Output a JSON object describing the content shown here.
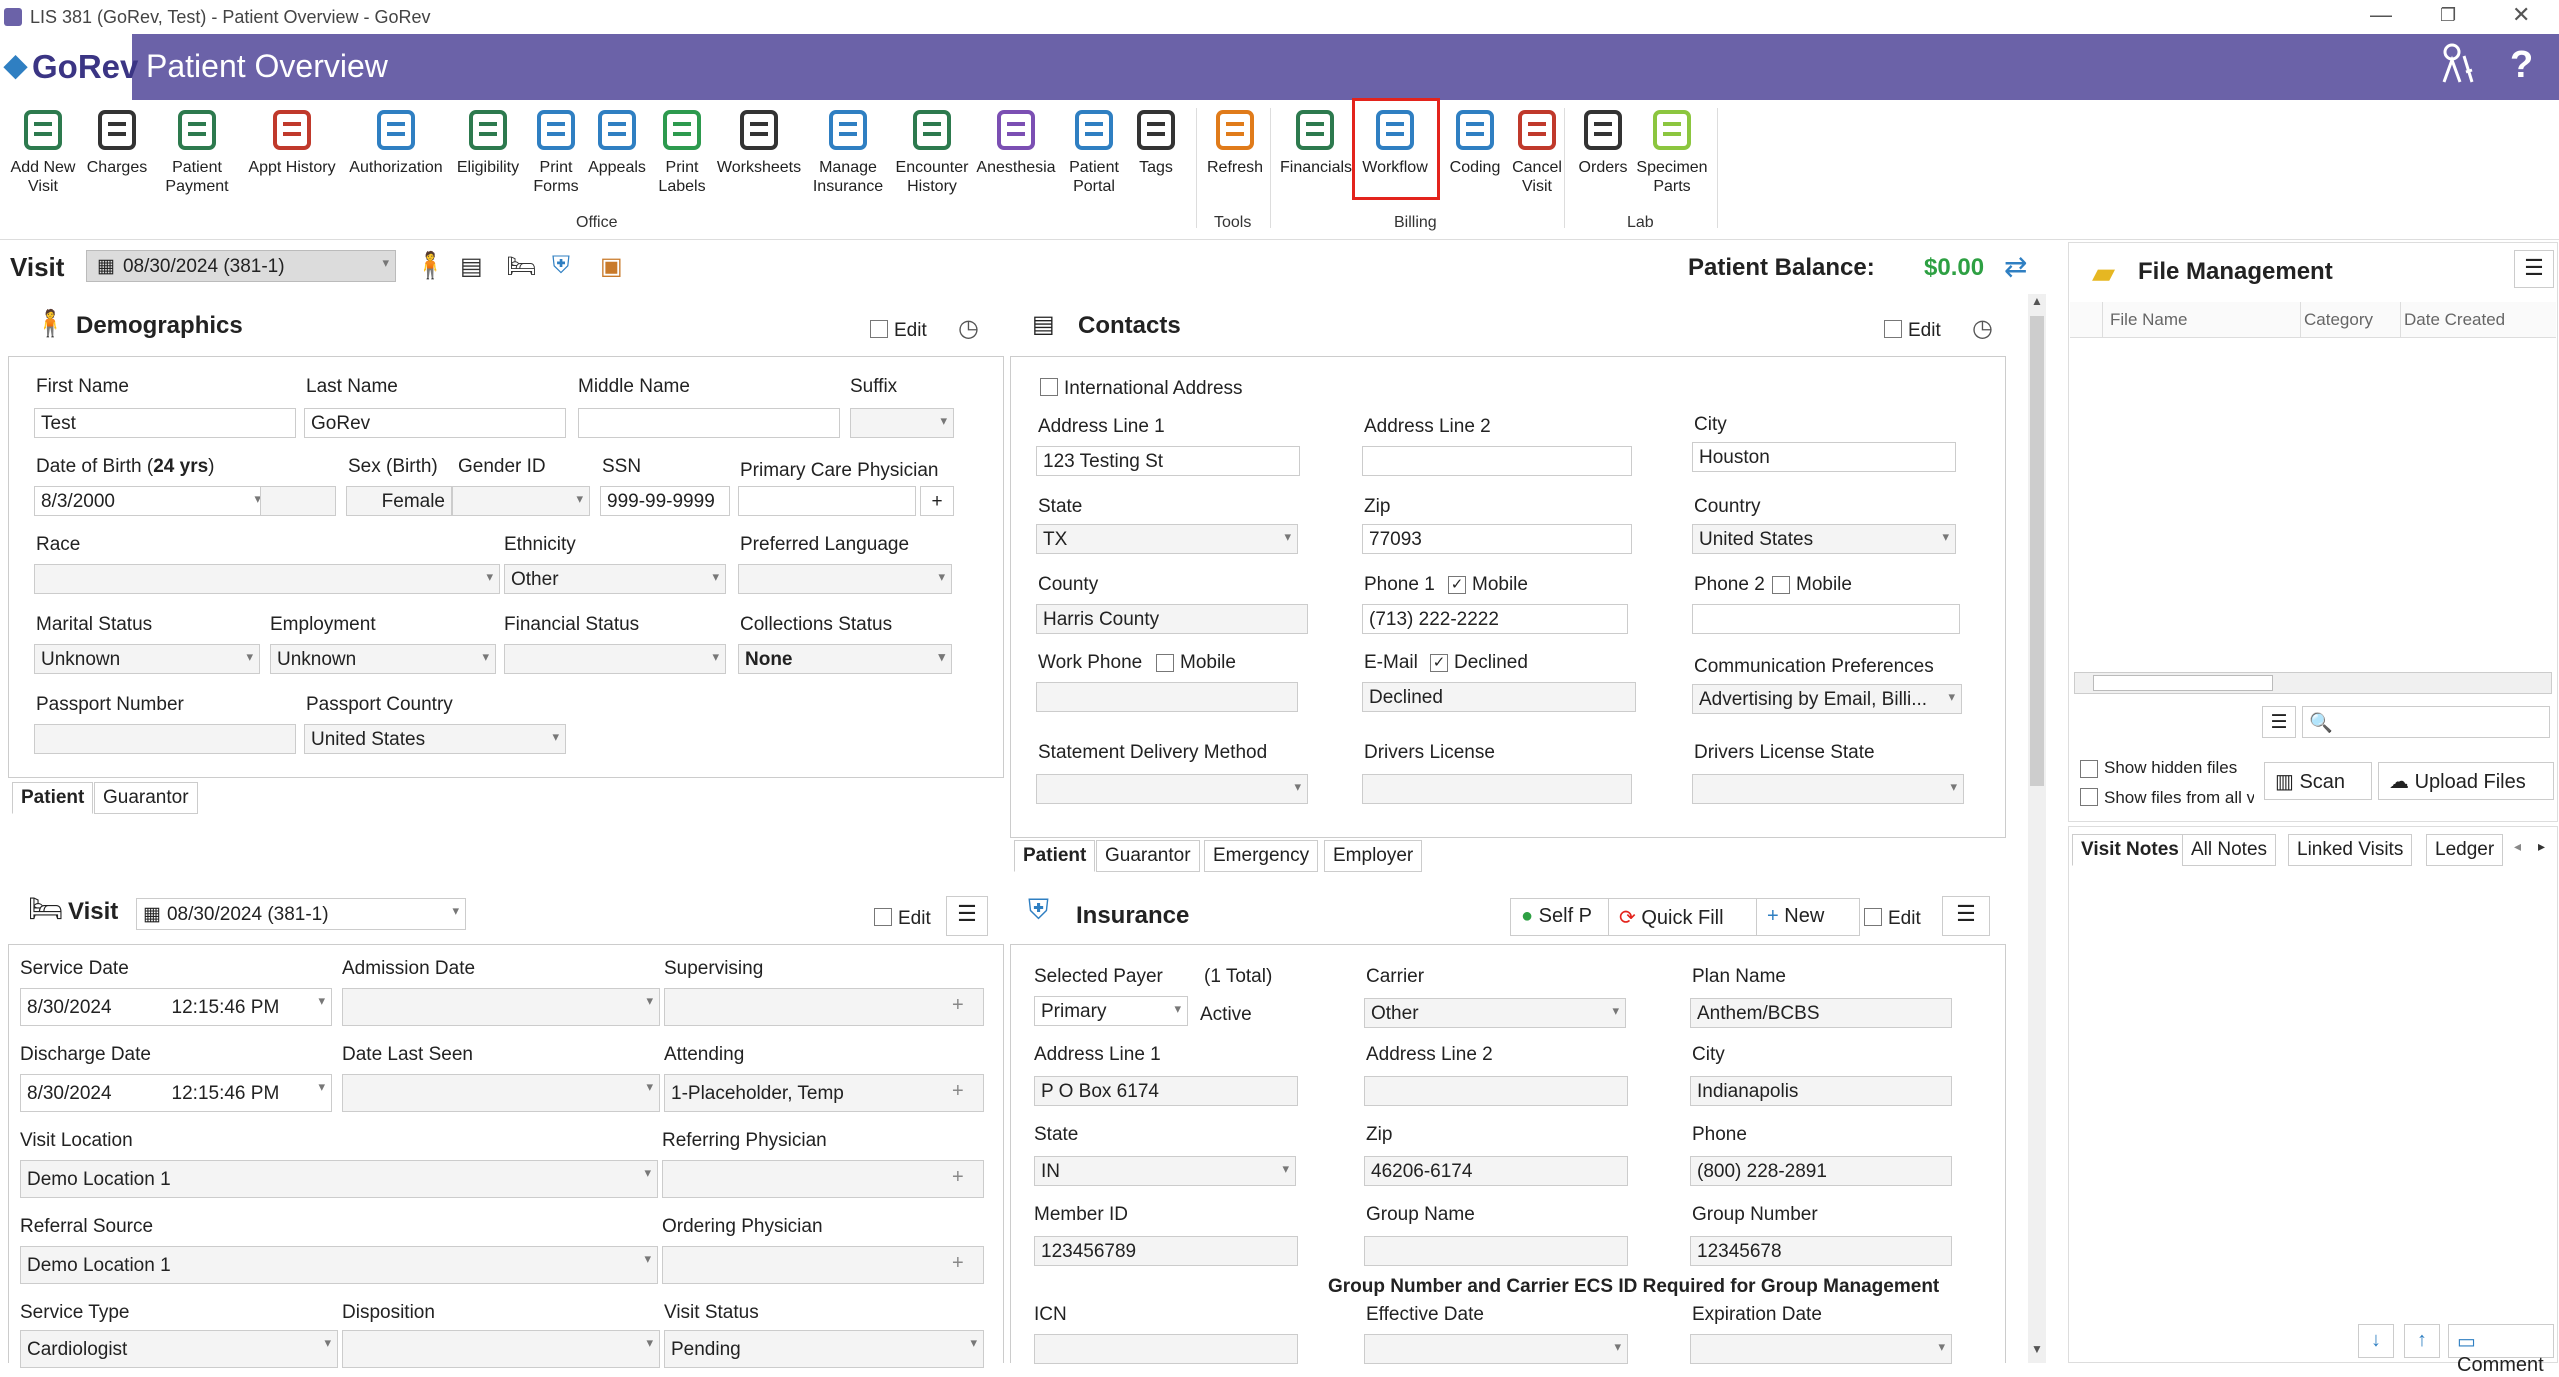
{
  "window": {
    "title": "LIS 381 (GoRev, Test) - Patient Overview - GoRev",
    "min": "—",
    "max": "❐",
    "close": "✕"
  },
  "app": {
    "logo": "GoRev",
    "page_title": "Patient Overview",
    "help": "?"
  },
  "ribbon": {
    "office": [
      "Add New Visit",
      "Charges",
      "Patient Payment",
      "Appt History",
      "Authorization",
      "Eligibility",
      "Print Forms",
      "Appeals",
      "Print Labels",
      "Worksheets",
      "Manage Insurance",
      "Encounter History",
      "Anesthesia",
      "Patient Portal",
      "Tags"
    ],
    "tools": [
      "Refresh"
    ],
    "billing": [
      "Financials",
      "Workflow",
      "Coding",
      "Cancel Visit"
    ],
    "lab": [
      "Orders",
      "Specimen Parts"
    ],
    "groups": {
      "office": "Office",
      "tools": "Tools",
      "billing": "Billing",
      "lab": "Lab"
    }
  },
  "visitbar": {
    "label": "Visit",
    "selected": "08/30/2024 (381-1)",
    "balance_label": "Patient Balance:",
    "balance": "$0.00"
  },
  "demographics": {
    "title": "Demographics",
    "edit": "Edit",
    "first_name_l": "First Name",
    "first_name": "Test",
    "last_name_l": "Last Name",
    "last_name": "GoRev",
    "middle_l": "Middle Name",
    "suffix_l": "Suffix",
    "dob_l": "Date of Birth (",
    "dob_age": "24 yrs",
    "dob_close": ")",
    "dob": "8/3/2000",
    "sex_l": "Sex (Birth)",
    "sex": "Female",
    "gender_l": "Gender ID",
    "ssn_l": "SSN",
    "ssn": "999-99-9999",
    "pcp_l": "Primary Care Physician",
    "race_l": "Race",
    "ethnicity_l": "Ethnicity",
    "ethnicity": "Other",
    "lang_l": "Preferred Language",
    "marital_l": "Marital Status",
    "marital": "Unknown",
    "employment_l": "Employment",
    "employment": "Unknown",
    "financial_l": "Financial Status",
    "collections_l": "Collections Status",
    "collections": "None",
    "passport_l": "Passport Number",
    "passport_country_l": "Passport Country",
    "passport_country": "United States",
    "tabs": [
      "Patient",
      "Guarantor"
    ]
  },
  "contacts": {
    "title": "Contacts",
    "edit": "Edit",
    "intl": "International Address",
    "addr1_l": "Address Line 1",
    "addr1": "123 Testing St",
    "addr2_l": "Address Line 2",
    "city_l": "City",
    "city": "Houston",
    "state_l": "State",
    "state": "TX",
    "zip_l": "Zip",
    "zip": "77093",
    "country_l": "Country",
    "country": "United States",
    "county_l": "County",
    "county": "Harris County",
    "phone1_l": "Phone 1",
    "mobile": "Mobile",
    "phone1": "(713) 222-2222",
    "phone2_l": "Phone 2",
    "work_l": "Work Phone",
    "email_l": "E-Mail",
    "declined_l": "Declined",
    "email": "Declined",
    "comm_l": "Communication Preferences",
    "comm": "Advertising by Email, Billi...",
    "stmt_l": "Statement Delivery Method",
    "dl_l": "Drivers License",
    "dls_l": "Drivers License State",
    "tabs": [
      "Patient",
      "Guarantor",
      "Emergency",
      "Employer"
    ]
  },
  "visit": {
    "title": "Visit",
    "selected": "08/30/2024 (381-1)",
    "edit": "Edit",
    "service_date_l": "Service Date",
    "service_date": "8/30/2024",
    "service_time": "12:15:46 PM",
    "admission_l": "Admission Date",
    "supervising_l": "Supervising",
    "discharge_l": "Discharge Date",
    "discharge_date": "8/30/2024",
    "discharge_time": "12:15:46 PM",
    "last_seen_l": "Date Last Seen",
    "attending_l": "Attending",
    "attending": "1-Placeholder, Temp",
    "location_l": "Visit Location",
    "location": "Demo Location 1",
    "referring_l": "Referring Physician",
    "ref_source_l": "Referral Source",
    "ref_source": "Demo Location 1",
    "ordering_l": "Ordering Physician",
    "service_type_l": "Service Type",
    "service_type": "Cardiologist",
    "disposition_l": "Disposition",
    "status_l": "Visit Status",
    "status": "Pending"
  },
  "insurance": {
    "title": "Insurance",
    "self_pay": "Self P",
    "quick_fill": "Quick Fill",
    "new": "New",
    "edit": "Edit",
    "payer_l": "Selected Payer",
    "total": "(1 Total)",
    "payer": "Primary",
    "active": "Active",
    "carrier_l": "Carrier",
    "carrier": "Other",
    "plan_l": "Plan Name",
    "plan": "Anthem/BCBS",
    "addr1_l": "Address Line 1",
    "addr1": "P O Box 6174",
    "addr2_l": "Address Line 2",
    "city_l": "City",
    "city": "Indianapolis",
    "state_l": "State",
    "state": "IN",
    "zip_l": "Zip",
    "zip": "46206-6174",
    "phone_l": "Phone",
    "phone": "(800) 228-2891",
    "member_l": "Member ID",
    "member": "123456789",
    "group_name_l": "Group Name",
    "group_num_l": "Group Number",
    "group_num": "12345678",
    "warning": "Group Number and Carrier ECS ID Required for Group Management",
    "icn_l": "ICN",
    "eff_l": "Effective Date",
    "exp_l": "Expiration Date"
  },
  "files": {
    "title": "File Management",
    "cols": [
      "File Name",
      "Category",
      "Date Created"
    ],
    "hidden": "Show hidden files",
    "all": "Show files from all visits",
    "scan": "Scan",
    "upload": "Upload Files"
  },
  "notes": {
    "tabs": [
      "Visit Notes",
      "All Notes",
      "Linked Visits",
      "Ledger"
    ],
    "comment": "Comment"
  }
}
